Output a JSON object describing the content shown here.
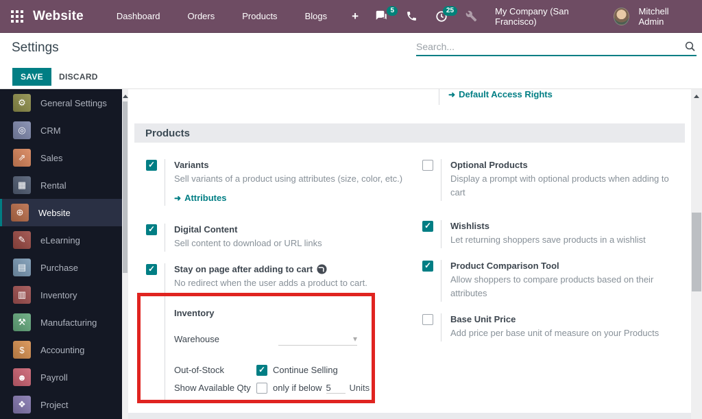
{
  "navbar": {
    "app_name": "Website",
    "menu": [
      "Dashboard",
      "Orders",
      "Products",
      "Blogs"
    ],
    "plus_label": "+",
    "messages_badge": "5",
    "activities_badge": "25",
    "company": "My Company (San Francisco)",
    "user": "Mitchell Admin",
    "bg_color": "#6e4c63",
    "badge_color": "#00827a"
  },
  "control_panel": {
    "title": "Settings",
    "save_label": "SAVE",
    "discard_label": "DISCARD",
    "search_placeholder": "Search..."
  },
  "sidebar": {
    "items": [
      {
        "label": "General Settings",
        "glyph": "⚙",
        "color": "#8e8e4a",
        "selected": false
      },
      {
        "label": "CRM",
        "glyph": "◎",
        "color": "#8089ad",
        "selected": false
      },
      {
        "label": "Sales",
        "glyph": "⇗",
        "color": "#d8845a",
        "selected": false
      },
      {
        "label": "Rental",
        "glyph": "▦",
        "color": "#515d73",
        "selected": false
      },
      {
        "label": "Website",
        "glyph": "⊕",
        "color": "#b96d49",
        "selected": true
      },
      {
        "label": "eLearning",
        "glyph": "✎",
        "color": "#9b4a44",
        "selected": false
      },
      {
        "label": "Purchase",
        "glyph": "▤",
        "color": "#7b9ab5",
        "selected": false
      },
      {
        "label": "Inventory",
        "glyph": "▥",
        "color": "#a05050",
        "selected": false
      },
      {
        "label": "Manufacturing",
        "glyph": "⚒",
        "color": "#64a97d",
        "selected": false
      },
      {
        "label": "Accounting",
        "glyph": "$",
        "color": "#d8904f",
        "selected": false
      },
      {
        "label": "Payroll",
        "glyph": "☻",
        "color": "#cc6272",
        "selected": false
      },
      {
        "label": "Project",
        "glyph": "❖",
        "color": "#8578b0",
        "selected": false
      }
    ]
  },
  "content": {
    "top_link": "Default Access Rights",
    "section_title": "Products",
    "left_items": [
      {
        "label": "Variants",
        "checked": true,
        "desc": "Sell variants of a product using attributes (size, color, etc.)",
        "link": "Attributes"
      },
      {
        "label": "Digital Content",
        "checked": true,
        "desc": "Sell content to download or URL links"
      },
      {
        "label": "Stay on page after adding to cart",
        "checked": true,
        "desc": "No redirect when the user adds a product to cart."
      }
    ],
    "right_items": [
      {
        "label": "Optional Products",
        "checked": false,
        "desc": "Display a prompt with optional products when adding to cart"
      },
      {
        "label": "Wishlists",
        "checked": true,
        "desc": "Let returning shoppers save products in a wishlist"
      },
      {
        "label": "Product Comparison Tool",
        "checked": true,
        "desc": "Allow shoppers to compare products based on their attributes"
      },
      {
        "label": "Base Unit Price",
        "checked": false,
        "desc": "Add price per base unit of measure on your Products"
      }
    ],
    "inventory": {
      "title": "Inventory",
      "warehouse_label": "Warehouse",
      "out_of_stock_label": "Out-of-Stock",
      "continue_selling_label": "Continue Selling",
      "continue_selling_checked": true,
      "show_qty_label": "Show Available Qty",
      "show_qty_checked": false,
      "only_if_below_label": "only if below",
      "qty_value": "5",
      "units_label": "Units"
    },
    "accent_color": "#017e84",
    "annotation_color": "#e02420"
  }
}
